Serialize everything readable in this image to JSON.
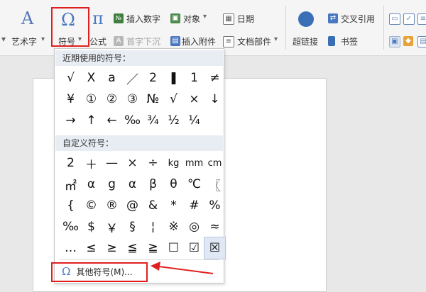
{
  "ribbon": {
    "art_text": "艺术字",
    "art_text_arrow": "▾",
    "symbol": "符号",
    "symbol_arrow": "▾",
    "formula": "公式",
    "insert_number": "插入数字",
    "drop_cap": "首字下沉",
    "object": "对象",
    "object_arrow": "▾",
    "insert_attachment": "插入附件",
    "date": "日期",
    "doc_parts": "文档部件",
    "doc_parts_arrow": "▾",
    "hyperlink": "超链接",
    "cross_ref": "交叉引用",
    "bookmark": "书签"
  },
  "dropdown": {
    "recent_title": "近期使用的符号：",
    "recent_symbols": [
      "√",
      "Χ",
      "a",
      "／",
      "2",
      "❚",
      "1",
      "≠",
      "¥",
      "①",
      "②",
      "③",
      "№",
      "√",
      "×",
      "↓",
      "→",
      "↑",
      "←",
      "‰",
      "¾",
      "½",
      "¼"
    ],
    "custom_title": "自定义符号：",
    "custom_symbols": [
      "2",
      "＋",
      "—",
      "×",
      "÷",
      "kg",
      "mm",
      "cm",
      "㎡",
      "α",
      "g",
      "α",
      "β",
      "θ",
      "℃",
      "〖",
      "{",
      "©",
      "®",
      "@",
      "&",
      "*",
      "#",
      "%",
      "‰",
      "$",
      "￥",
      "§",
      "¦",
      "※",
      "◎",
      "≈",
      "…",
      "≤",
      "≥",
      "≦",
      "≧",
      "☐",
      "☑",
      "☒"
    ],
    "more_label": "其他符号(M)..."
  },
  "colors": {
    "accent": "#4a78c0",
    "highlight": "#e02020",
    "section_bg": "#e8edf3"
  }
}
